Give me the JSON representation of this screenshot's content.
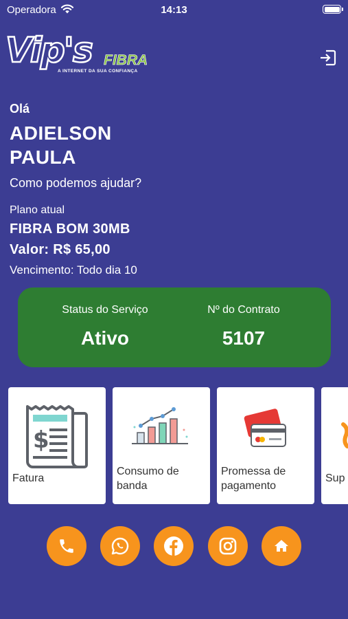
{
  "status_bar": {
    "carrier": "Operadora",
    "time": "14:13"
  },
  "logo": {
    "main": "Vip's",
    "fibra": "FIBRA",
    "tagline": "A INTERNET DA SUA CONFIANÇA"
  },
  "greeting": {
    "hello": "Olá",
    "name_line1": "ADIELSON",
    "name_line2": "PAULA",
    "help": "Como podemos ajudar?"
  },
  "plan": {
    "label": "Plano atual",
    "name": "FIBRA BOM 30MB",
    "value": "Valor: R$ 65,00",
    "due": "Vencimento: Todo dia 10"
  },
  "service": {
    "status_label": "Status do Serviço",
    "status_value": "Ativo",
    "contract_label": "Nº do Contrato",
    "contract_value": "5107"
  },
  "menu": [
    {
      "label": "Fatura",
      "icon": "invoice-icon"
    },
    {
      "label_line1": "Consumo de",
      "label_line2": "banda",
      "icon": "bar-chart-icon"
    },
    {
      "label_line1": "Promessa de",
      "label_line2": "pagamento",
      "icon": "credit-card-icon"
    },
    {
      "label": "Sup",
      "icon": "support-icon"
    }
  ],
  "actions": [
    {
      "icon": "phone-icon"
    },
    {
      "icon": "whatsapp-icon"
    },
    {
      "icon": "facebook-icon"
    },
    {
      "icon": "instagram-icon"
    },
    {
      "icon": "home-icon"
    }
  ],
  "colors": {
    "background": "#3c3d93",
    "status_card": "#2e7d32",
    "action_button": "#f7941d",
    "logo_green": "#8bc34a"
  }
}
